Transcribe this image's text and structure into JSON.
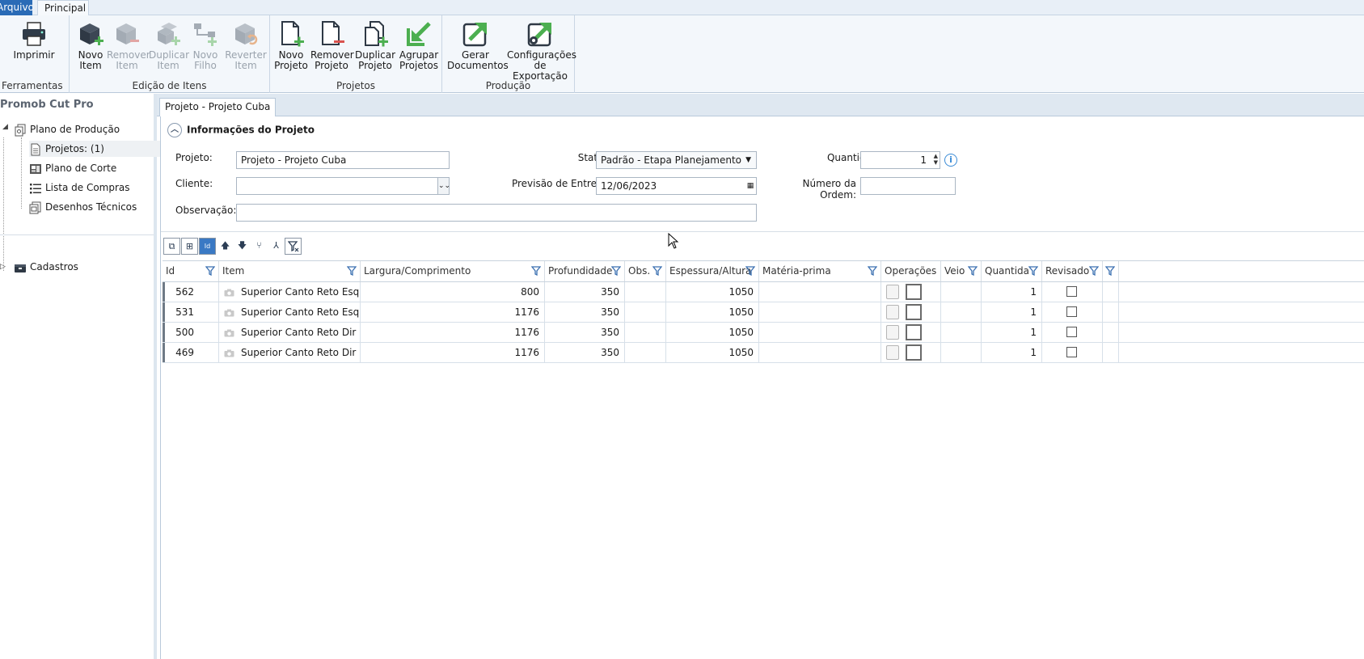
{
  "menu": {
    "file_tab": "Arquivo",
    "principal_tab": "Principal"
  },
  "ribbon": {
    "groups": [
      {
        "label": "Ferramentas",
        "buttons": [
          {
            "label": "Imprimir"
          }
        ]
      },
      {
        "label": "Edição de Itens",
        "buttons": [
          {
            "line1": "Novo",
            "line2": "Item"
          },
          {
            "line1": "Remover",
            "line2": "Item"
          },
          {
            "line1": "Duplicar",
            "line2": "Item"
          },
          {
            "line1": "Novo",
            "line2": "Filho"
          },
          {
            "line1": "Reverter",
            "line2": "Item"
          }
        ]
      },
      {
        "label": "Projetos",
        "buttons": [
          {
            "line1": "Novo",
            "line2": "Projeto"
          },
          {
            "line1": "Remover",
            "line2": "Projeto"
          },
          {
            "line1": "Duplicar",
            "line2": "Projeto"
          },
          {
            "line1": "Agrupar",
            "line2": "Projetos"
          }
        ]
      },
      {
        "label": "Produção",
        "buttons": [
          {
            "line1": "Gerar",
            "line2": "Documentos"
          },
          {
            "line1": "Configurações",
            "line2": "de Exportação"
          }
        ]
      }
    ]
  },
  "tree": {
    "title": "Promob Cut Pro",
    "root": "Plano de Produção",
    "children": [
      "Projetos: (1)",
      "Plano de Corte",
      "Lista de Compras",
      "Desenhos Técnicos"
    ],
    "cadastros": "Cadastros"
  },
  "doc_tab": "Projeto - Projeto Cuba",
  "info": {
    "header": "Informações do Projeto",
    "projeto_label": "Projeto:",
    "projeto_value": "Projeto - Projeto Cuba",
    "cliente_label": "Cliente:",
    "cliente_value": "",
    "observacao_label": "Observação:",
    "observacao_value": "",
    "status_label": "Status:",
    "status_value": "Padrão - Etapa Planejamento",
    "previsao_label": "Previsão de Entrega:",
    "previsao_value": "12/06/2023",
    "quantidade_label": "Quantidade:",
    "quantidade_value": "1",
    "ordem_label": "Número da Ordem:",
    "ordem_value": ""
  },
  "grid": {
    "columns": [
      "Id",
      "Item",
      "Largura/Comprimento",
      "Profundidade",
      "Obs.",
      "Espessura/Altura",
      "Matéria-prima",
      "Operações",
      "Veio",
      "Quantida",
      "Revisado",
      ""
    ],
    "rows": [
      {
        "id": "562",
        "item": "Superior Canto Reto Esq",
        "largura": "800",
        "profundidade": "350",
        "obs": "",
        "espessura": "1050",
        "materia": "",
        "veio": "",
        "quantidade": "1"
      },
      {
        "id": "531",
        "item": "Superior Canto Reto Esq",
        "largura": "1176",
        "profundidade": "350",
        "obs": "",
        "espessura": "1050",
        "materia": "",
        "veio": "",
        "quantidade": "1"
      },
      {
        "id": "500",
        "item": "Superior Canto Reto Dir",
        "largura": "1176",
        "profundidade": "350",
        "obs": "",
        "espessura": "1050",
        "materia": "",
        "veio": "",
        "quantidade": "1"
      },
      {
        "id": "469",
        "item": "Superior Canto Reto Dir",
        "largura": "1176",
        "profundidade": "350",
        "obs": "",
        "espessura": "1050",
        "materia": "",
        "veio": "",
        "quantidade": "1"
      }
    ]
  },
  "colors": {
    "accent": "#2a6bb6",
    "green_icon": "#4caf50",
    "red_icon": "#d9534f"
  }
}
